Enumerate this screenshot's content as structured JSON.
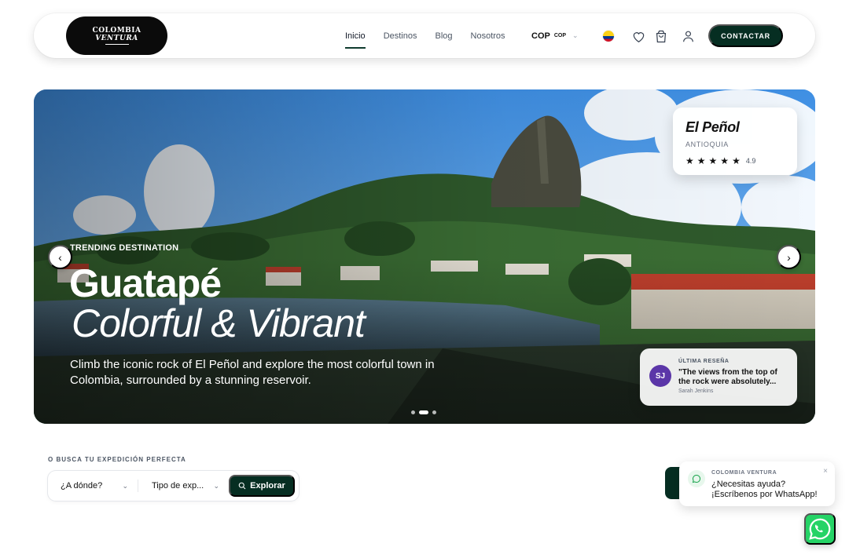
{
  "nav": {
    "logo_line1": "COLOMBIA",
    "logo_line2": "VENTURA",
    "menu": [
      {
        "label": "Inicio",
        "active": true
      },
      {
        "label": "Destinos",
        "active": false
      },
      {
        "label": "Blog",
        "active": false
      },
      {
        "label": "Nosotros",
        "active": false
      }
    ],
    "currency": "COP",
    "currency_small": "COP",
    "icons": [
      "colombia-flag-icon",
      "heart-icon",
      "cart-icon",
      "user-icon"
    ],
    "contact_label": "CONTACTAR"
  },
  "hero": {
    "tag": "TRENDING DESTINATION",
    "title": "Guatapé",
    "subtitle": "Colorful & Vibrant",
    "description": "Climb the iconic rock of El Peñol and explore the most colorful town in Colombia, surrounded by a stunning reservoir.",
    "prev_icon": "chevron-left-icon",
    "next_icon": "chevron-right-icon",
    "slides": 3,
    "active_slide": 2,
    "destination_card": {
      "name": "El Peñol",
      "region": "ANTIOQUIA",
      "stars": 5,
      "rating": "4.9"
    },
    "review_card": {
      "label": "ÚLTIMA RESEÑA",
      "initials": "SJ",
      "quote": "\"The views from the top of the rock were absolutely...",
      "author": "Sarah Jenkins"
    }
  },
  "search": {
    "label": "O BUSCA TU EXPEDICIÓN PERFECTA",
    "where_placeholder": "¿A dónde?",
    "type_placeholder": "Tipo de exp...",
    "button_label": "Explorar"
  },
  "whatsapp": {
    "brand": "COLOMBIA VENTURA",
    "line1": "¿Necesitas ayuda?",
    "line2": "¡Escríbenos por WhatsApp!",
    "close": "×"
  },
  "colors": {
    "primary": "#062e22",
    "whatsapp": "#25d366",
    "avatar": "#5b36a8"
  }
}
